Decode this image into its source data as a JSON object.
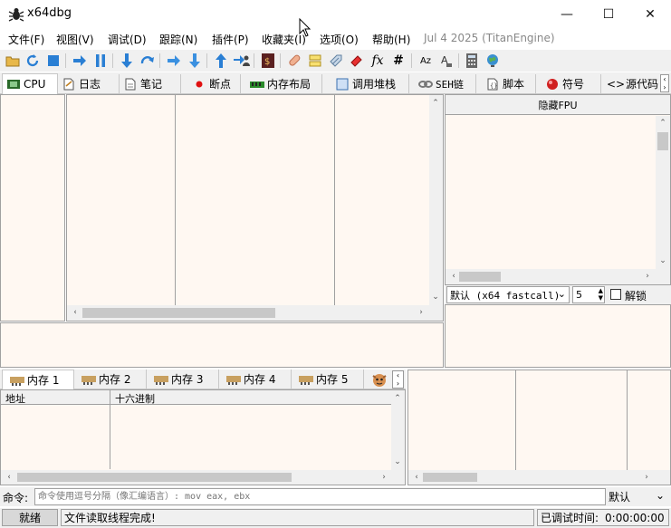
{
  "window": {
    "title": "x64dbg",
    "minimize_glyph": "—",
    "maximize_glyph": "☐",
    "close_glyph": "✕"
  },
  "menu": {
    "items": [
      "文件(F)",
      "视图(V)",
      "调试(D)",
      "跟踪(N)",
      "插件(P)",
      "收藏夹(I)",
      "选项(O)",
      "帮助(H)"
    ],
    "date": "Jul 4 2025 (TitanEngine)"
  },
  "tabs": [
    "CPU",
    "日志",
    "笔记",
    "断点",
    "内存布局",
    "调用堆栈",
    "SEH链",
    "脚本",
    "符号",
    "源代码"
  ],
  "fpu": {
    "toggle_label": "隐藏FPU"
  },
  "callconv": {
    "selected": "默认 (x64 fastcall)",
    "args_value": "5",
    "lock_label": "解锁"
  },
  "memory_tabs": [
    "内存 1",
    "内存 2",
    "内存 3",
    "内存 4",
    "内存 5"
  ],
  "dump": {
    "col_address": "地址",
    "col_hex": "十六进制"
  },
  "command": {
    "label": "命令:",
    "placeholder": "命令使用逗号分隔（像汇编语言）: mov eax, ebx",
    "mode": "默认"
  },
  "status": {
    "state": "就绪",
    "message": "文件读取线程完成!",
    "debug_time_label": "已调试时间:",
    "debug_time": "0:00:00:00"
  },
  "colors": {
    "pane_bg": "#fff8f2",
    "chrome_bg": "#f0f0f0",
    "border": "#a0a0a0",
    "date_text": "#888888"
  }
}
